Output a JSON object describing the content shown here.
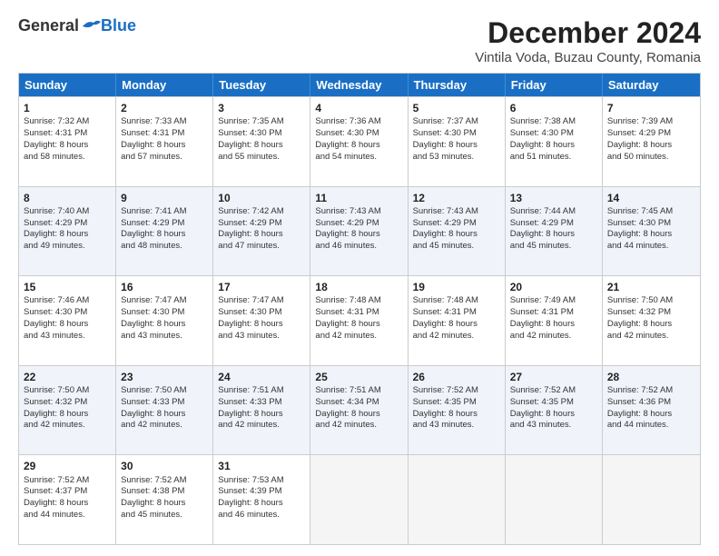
{
  "logo": {
    "general": "General",
    "blue": "Blue"
  },
  "title": "December 2024",
  "subtitle": "Vintila Voda, Buzau County, Romania",
  "days": [
    "Sunday",
    "Monday",
    "Tuesday",
    "Wednesday",
    "Thursday",
    "Friday",
    "Saturday"
  ],
  "weeks": [
    [
      {
        "day": "1",
        "sunrise": "7:32 AM",
        "sunset": "4:31 PM",
        "daylight": "8 hours and 58 minutes."
      },
      {
        "day": "2",
        "sunrise": "7:33 AM",
        "sunset": "4:31 PM",
        "daylight": "8 hours and 57 minutes."
      },
      {
        "day": "3",
        "sunrise": "7:35 AM",
        "sunset": "4:30 PM",
        "daylight": "8 hours and 55 minutes."
      },
      {
        "day": "4",
        "sunrise": "7:36 AM",
        "sunset": "4:30 PM",
        "daylight": "8 hours and 54 minutes."
      },
      {
        "day": "5",
        "sunrise": "7:37 AM",
        "sunset": "4:30 PM",
        "daylight": "8 hours and 53 minutes."
      },
      {
        "day": "6",
        "sunrise": "7:38 AM",
        "sunset": "4:30 PM",
        "daylight": "8 hours and 51 minutes."
      },
      {
        "day": "7",
        "sunrise": "7:39 AM",
        "sunset": "4:29 PM",
        "daylight": "8 hours and 50 minutes."
      }
    ],
    [
      {
        "day": "8",
        "sunrise": "7:40 AM",
        "sunset": "4:29 PM",
        "daylight": "8 hours and 49 minutes."
      },
      {
        "day": "9",
        "sunrise": "7:41 AM",
        "sunset": "4:29 PM",
        "daylight": "8 hours and 48 minutes."
      },
      {
        "day": "10",
        "sunrise": "7:42 AM",
        "sunset": "4:29 PM",
        "daylight": "8 hours and 47 minutes."
      },
      {
        "day": "11",
        "sunrise": "7:43 AM",
        "sunset": "4:29 PM",
        "daylight": "8 hours and 46 minutes."
      },
      {
        "day": "12",
        "sunrise": "7:43 AM",
        "sunset": "4:29 PM",
        "daylight": "8 hours and 45 minutes."
      },
      {
        "day": "13",
        "sunrise": "7:44 AM",
        "sunset": "4:29 PM",
        "daylight": "8 hours and 45 minutes."
      },
      {
        "day": "14",
        "sunrise": "7:45 AM",
        "sunset": "4:30 PM",
        "daylight": "8 hours and 44 minutes."
      }
    ],
    [
      {
        "day": "15",
        "sunrise": "7:46 AM",
        "sunset": "4:30 PM",
        "daylight": "8 hours and 43 minutes."
      },
      {
        "day": "16",
        "sunrise": "7:47 AM",
        "sunset": "4:30 PM",
        "daylight": "8 hours and 43 minutes."
      },
      {
        "day": "17",
        "sunrise": "7:47 AM",
        "sunset": "4:30 PM",
        "daylight": "8 hours and 43 minutes."
      },
      {
        "day": "18",
        "sunrise": "7:48 AM",
        "sunset": "4:31 PM",
        "daylight": "8 hours and 42 minutes."
      },
      {
        "day": "19",
        "sunrise": "7:48 AM",
        "sunset": "4:31 PM",
        "daylight": "8 hours and 42 minutes."
      },
      {
        "day": "20",
        "sunrise": "7:49 AM",
        "sunset": "4:31 PM",
        "daylight": "8 hours and 42 minutes."
      },
      {
        "day": "21",
        "sunrise": "7:50 AM",
        "sunset": "4:32 PM",
        "daylight": "8 hours and 42 minutes."
      }
    ],
    [
      {
        "day": "22",
        "sunrise": "7:50 AM",
        "sunset": "4:32 PM",
        "daylight": "8 hours and 42 minutes."
      },
      {
        "day": "23",
        "sunrise": "7:50 AM",
        "sunset": "4:33 PM",
        "daylight": "8 hours and 42 minutes."
      },
      {
        "day": "24",
        "sunrise": "7:51 AM",
        "sunset": "4:33 PM",
        "daylight": "8 hours and 42 minutes."
      },
      {
        "day": "25",
        "sunrise": "7:51 AM",
        "sunset": "4:34 PM",
        "daylight": "8 hours and 42 minutes."
      },
      {
        "day": "26",
        "sunrise": "7:52 AM",
        "sunset": "4:35 PM",
        "daylight": "8 hours and 43 minutes."
      },
      {
        "day": "27",
        "sunrise": "7:52 AM",
        "sunset": "4:35 PM",
        "daylight": "8 hours and 43 minutes."
      },
      {
        "day": "28",
        "sunrise": "7:52 AM",
        "sunset": "4:36 PM",
        "daylight": "8 hours and 44 minutes."
      }
    ],
    [
      {
        "day": "29",
        "sunrise": "7:52 AM",
        "sunset": "4:37 PM",
        "daylight": "8 hours and 44 minutes."
      },
      {
        "day": "30",
        "sunrise": "7:52 AM",
        "sunset": "4:38 PM",
        "daylight": "8 hours and 45 minutes."
      },
      {
        "day": "31",
        "sunrise": "7:53 AM",
        "sunset": "4:39 PM",
        "daylight": "8 hours and 46 minutes."
      },
      null,
      null,
      null,
      null
    ]
  ]
}
